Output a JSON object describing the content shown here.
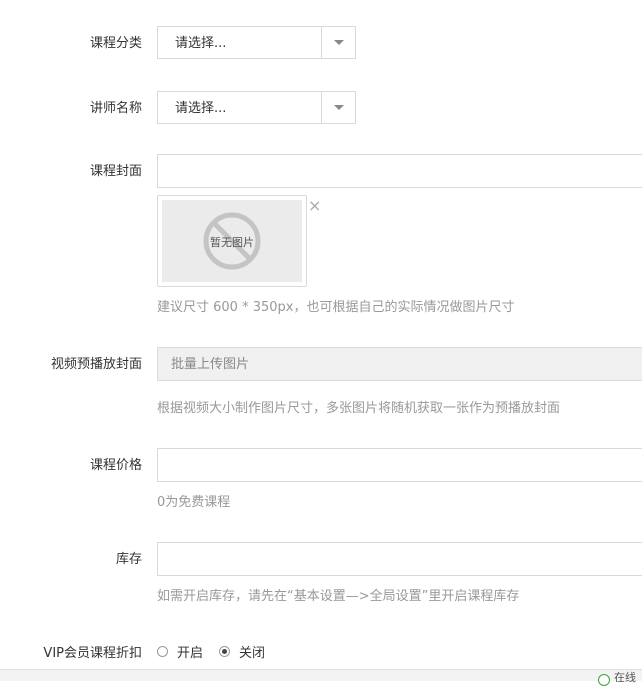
{
  "course_category": {
    "label": "课程分类",
    "value": "请选择..."
  },
  "teacher_name": {
    "label": "讲师名称",
    "value": "请选择..."
  },
  "course_cover": {
    "label": "课程封面",
    "no_image_text": "暂无图片",
    "remove_symbol": "×",
    "hint": "建议尺寸 600 * 350px，也可根据自己的实际情况做图片尺寸"
  },
  "video_preview_cover": {
    "label": "视频预播放封面",
    "button_label": "批量上传图片",
    "hint": "根据视频大小制作图片尺寸，多张图片将随机获取一张作为预播放封面"
  },
  "course_price": {
    "label": "课程价格",
    "hint": "0为免费课程"
  },
  "stock": {
    "label": "库存",
    "hint": "如需开启库存，请先在“基本设置—>全局设置”里开启课程库存"
  },
  "vip_discount": {
    "label": "VIP会员课程折扣",
    "options": [
      {
        "label": "开启",
        "checked": false
      },
      {
        "label": "关闭",
        "checked": true
      }
    ]
  },
  "status_bar": {
    "text": "在线"
  }
}
